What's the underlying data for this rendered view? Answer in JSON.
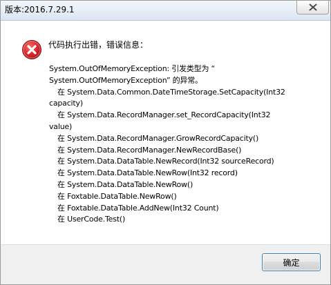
{
  "window": {
    "title": "版本:2016.7.29.1"
  },
  "dialog": {
    "heading": "代码执行出错，错误信息：",
    "message_lines": [
      {
        "text": "System.OutOfMemoryException: 引发类型为 “",
        "indent": false
      },
      {
        "text": "System.OutOfMemoryException” 的异常。",
        "indent": false
      },
      {
        "text": "在 System.Data.Common.DateTimeStorage.SetCapacity(Int32",
        "indent": true
      },
      {
        "text": "capacity)",
        "indent": false
      },
      {
        "text": "在 System.Data.RecordManager.set_RecordCapacity(Int32",
        "indent": true
      },
      {
        "text": "value)",
        "indent": false
      },
      {
        "text": "在 System.Data.RecordManager.GrowRecordCapacity()",
        "indent": true
      },
      {
        "text": "在 System.Data.RecordManager.NewRecordBase()",
        "indent": true
      },
      {
        "text": "在 System.Data.DataTable.NewRecord(Int32 sourceRecord)",
        "indent": true
      },
      {
        "text": "在 System.Data.DataTable.NewRow(Int32 record)",
        "indent": true
      },
      {
        "text": "在 System.Data.DataTable.NewRow()",
        "indent": true
      },
      {
        "text": "在 Foxtable.DataTable.NewRow()",
        "indent": true
      },
      {
        "text": "在 Foxtable.DataTable.AddNew(Int32 Count)",
        "indent": true
      },
      {
        "text": "在 UserCode.Test()",
        "indent": true
      }
    ],
    "ok_label": "确定"
  },
  "icons": {
    "error": "error-icon",
    "close": "close-icon"
  },
  "colors": {
    "error_red": "#d8262a",
    "button_border": "#3c7fb1"
  }
}
